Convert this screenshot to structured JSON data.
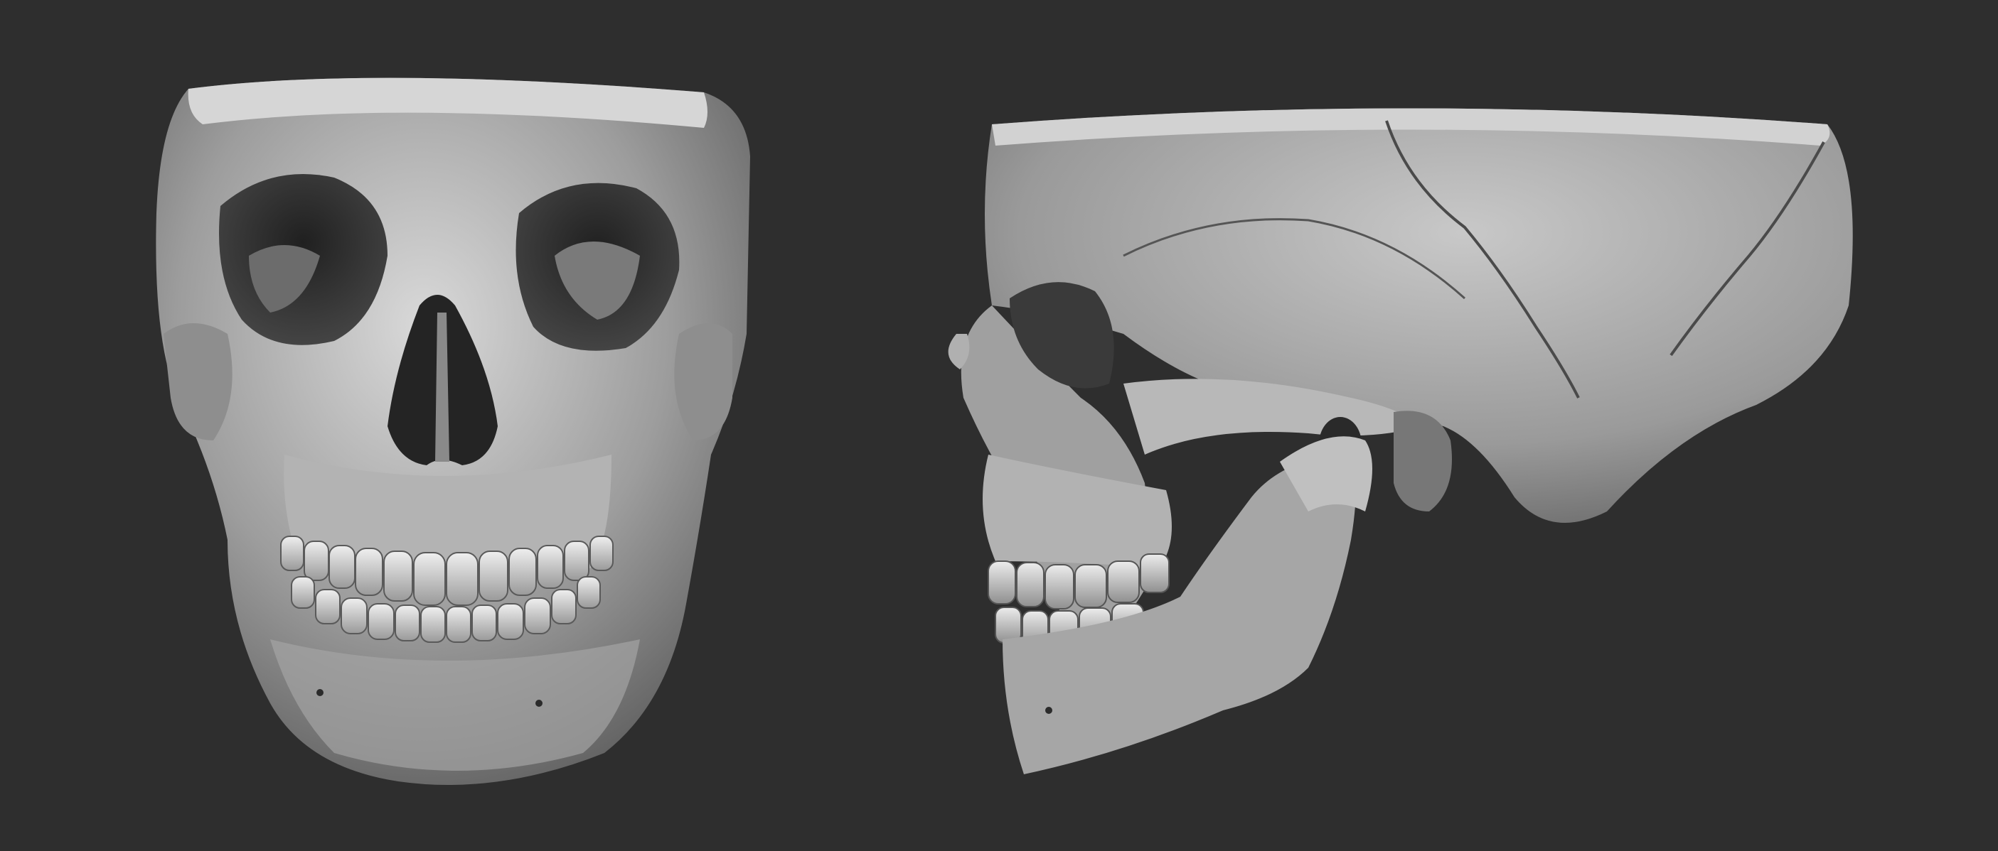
{
  "scene": {
    "background_color": "#2e2e2e",
    "bone_base_color": "#a9a9a9",
    "bone_highlight_color": "#e6e6e6",
    "bone_shadow_color": "#3c3c3c",
    "views": [
      {
        "name": "front",
        "subject": "skull-front-view"
      },
      {
        "name": "side",
        "subject": "skull-side-view"
      }
    ]
  }
}
